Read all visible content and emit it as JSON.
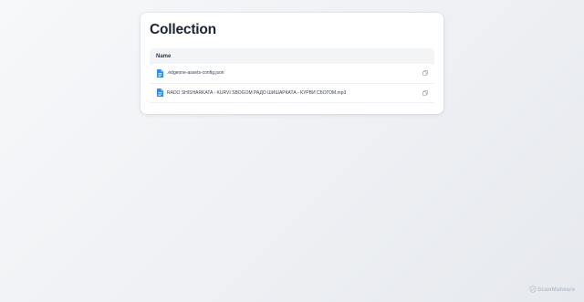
{
  "page": {
    "title": "Collection"
  },
  "table": {
    "header": "Name",
    "files": [
      {
        "name": ".edgeone-assets-config.json",
        "icon": "document-icon"
      },
      {
        "name": "RADO SHISHARKATA - KURVI SBOGOM РАДО ШИШАРКАТА - КУРВИ СБОГОМ.mp3",
        "icon": "document-icon"
      }
    ]
  },
  "watermark": {
    "text": "ScanMalware"
  },
  "colors": {
    "accent": "#2f8ee8",
    "title": "#1c2535",
    "watermark": "#b9c1cd"
  }
}
